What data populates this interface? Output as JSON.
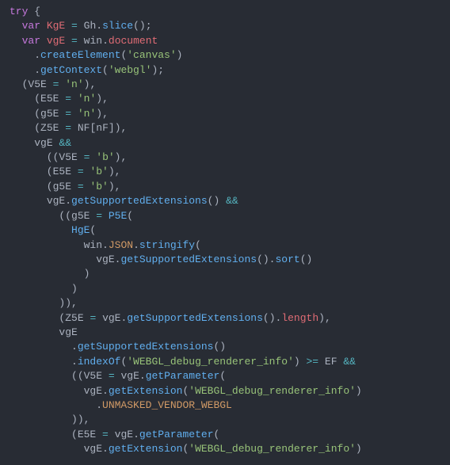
{
  "tokens": [
    [
      [
        "kw",
        "try"
      ],
      [
        "punc",
        " "
      ],
      [
        "brace",
        "{"
      ]
    ],
    [
      [
        "punc",
        "  "
      ],
      [
        "kw",
        "var"
      ],
      [
        "punc",
        " "
      ],
      [
        "var",
        "KgE"
      ],
      [
        "punc",
        " "
      ],
      [
        "op",
        "="
      ],
      [
        "punc",
        " "
      ],
      [
        "ident",
        "Gh"
      ],
      [
        "punc",
        "."
      ],
      [
        "func",
        "slice"
      ],
      [
        "punc",
        "();"
      ]
    ],
    [
      [
        "punc",
        "  "
      ],
      [
        "kw",
        "var"
      ],
      [
        "punc",
        " "
      ],
      [
        "var",
        "vgE"
      ],
      [
        "punc",
        " "
      ],
      [
        "op",
        "="
      ],
      [
        "punc",
        " "
      ],
      [
        "ident",
        "win"
      ],
      [
        "punc",
        "."
      ],
      [
        "prop",
        "document"
      ]
    ],
    [
      [
        "punc",
        "    ."
      ],
      [
        "func",
        "createElement"
      ],
      [
        "punc",
        "("
      ],
      [
        "str",
        "'canvas'"
      ],
      [
        "punc",
        ")"
      ]
    ],
    [
      [
        "punc",
        "    ."
      ],
      [
        "func",
        "getContext"
      ],
      [
        "punc",
        "("
      ],
      [
        "str",
        "'webgl'"
      ],
      [
        "punc",
        ");"
      ]
    ],
    [
      [
        "punc",
        "  ("
      ],
      [
        "ident",
        "V5E"
      ],
      [
        "punc",
        " "
      ],
      [
        "op",
        "="
      ],
      [
        "punc",
        " "
      ],
      [
        "str",
        "'n'"
      ],
      [
        "punc",
        "),"
      ]
    ],
    [
      [
        "punc",
        "    ("
      ],
      [
        "ident",
        "E5E"
      ],
      [
        "punc",
        " "
      ],
      [
        "op",
        "="
      ],
      [
        "punc",
        " "
      ],
      [
        "str",
        "'n'"
      ],
      [
        "punc",
        "),"
      ]
    ],
    [
      [
        "punc",
        "    ("
      ],
      [
        "ident",
        "g5E"
      ],
      [
        "punc",
        " "
      ],
      [
        "op",
        "="
      ],
      [
        "punc",
        " "
      ],
      [
        "str",
        "'n'"
      ],
      [
        "punc",
        "),"
      ]
    ],
    [
      [
        "punc",
        "    ("
      ],
      [
        "ident",
        "Z5E"
      ],
      [
        "punc",
        " "
      ],
      [
        "op",
        "="
      ],
      [
        "punc",
        " "
      ],
      [
        "ident",
        "NF"
      ],
      [
        "brk",
        "["
      ],
      [
        "ident",
        "nF"
      ],
      [
        "brk",
        "]"
      ],
      [
        "punc",
        "),"
      ]
    ],
    [
      [
        "punc",
        "    "
      ],
      [
        "ident",
        "vgE"
      ],
      [
        "punc",
        " "
      ],
      [
        "op",
        "&&"
      ]
    ],
    [
      [
        "punc",
        "      (("
      ],
      [
        "ident",
        "V5E"
      ],
      [
        "punc",
        " "
      ],
      [
        "op",
        "="
      ],
      [
        "punc",
        " "
      ],
      [
        "str",
        "'b'"
      ],
      [
        "punc",
        "),"
      ]
    ],
    [
      [
        "punc",
        "      ("
      ],
      [
        "ident",
        "E5E"
      ],
      [
        "punc",
        " "
      ],
      [
        "op",
        "="
      ],
      [
        "punc",
        " "
      ],
      [
        "str",
        "'b'"
      ],
      [
        "punc",
        "),"
      ]
    ],
    [
      [
        "punc",
        "      ("
      ],
      [
        "ident",
        "g5E"
      ],
      [
        "punc",
        " "
      ],
      [
        "op",
        "="
      ],
      [
        "punc",
        " "
      ],
      [
        "str",
        "'b'"
      ],
      [
        "punc",
        "),"
      ]
    ],
    [
      [
        "punc",
        "      "
      ],
      [
        "ident",
        "vgE"
      ],
      [
        "punc",
        "."
      ],
      [
        "func",
        "getSupportedExtensions"
      ],
      [
        "punc",
        "() "
      ],
      [
        "op",
        "&&"
      ]
    ],
    [
      [
        "punc",
        "        (("
      ],
      [
        "ident",
        "g5E"
      ],
      [
        "punc",
        " "
      ],
      [
        "op",
        "="
      ],
      [
        "punc",
        " "
      ],
      [
        "func",
        "P5E"
      ],
      [
        "punc",
        "("
      ]
    ],
    [
      [
        "punc",
        "          "
      ],
      [
        "func",
        "HgE"
      ],
      [
        "punc",
        "("
      ]
    ],
    [
      [
        "punc",
        "            "
      ],
      [
        "ident",
        "win"
      ],
      [
        "punc",
        "."
      ],
      [
        "const",
        "JSON"
      ],
      [
        "punc",
        "."
      ],
      [
        "func",
        "stringify"
      ],
      [
        "punc",
        "("
      ]
    ],
    [
      [
        "punc",
        "              "
      ],
      [
        "ident",
        "vgE"
      ],
      [
        "punc",
        "."
      ],
      [
        "func",
        "getSupportedExtensions"
      ],
      [
        "punc",
        "()."
      ],
      [
        "func",
        "sort"
      ],
      [
        "punc",
        "()"
      ]
    ],
    [
      [
        "punc",
        "            )"
      ]
    ],
    [
      [
        "punc",
        "          )"
      ]
    ],
    [
      [
        "punc",
        "        )),"
      ]
    ],
    [
      [
        "punc",
        "        ("
      ],
      [
        "ident",
        "Z5E"
      ],
      [
        "punc",
        " "
      ],
      [
        "op",
        "="
      ],
      [
        "punc",
        " "
      ],
      [
        "ident",
        "vgE"
      ],
      [
        "punc",
        "."
      ],
      [
        "func",
        "getSupportedExtensions"
      ],
      [
        "punc",
        "()."
      ],
      [
        "prop",
        "length"
      ],
      [
        "punc",
        "),"
      ]
    ],
    [
      [
        "punc",
        "        "
      ],
      [
        "ident",
        "vgE"
      ]
    ],
    [
      [
        "punc",
        "          ."
      ],
      [
        "func",
        "getSupportedExtensions"
      ],
      [
        "punc",
        "()"
      ]
    ],
    [
      [
        "punc",
        "          ."
      ],
      [
        "func",
        "indexOf"
      ],
      [
        "punc",
        "("
      ],
      [
        "str",
        "'WEBGL_debug_renderer_info'"
      ],
      [
        "punc",
        ") "
      ],
      [
        "op",
        ">="
      ],
      [
        "punc",
        " "
      ],
      [
        "ident",
        "EF"
      ],
      [
        "punc",
        " "
      ],
      [
        "op",
        "&&"
      ]
    ],
    [
      [
        "punc",
        "          (("
      ],
      [
        "ident",
        "V5E"
      ],
      [
        "punc",
        " "
      ],
      [
        "op",
        "="
      ],
      [
        "punc",
        " "
      ],
      [
        "ident",
        "vgE"
      ],
      [
        "punc",
        "."
      ],
      [
        "func",
        "getParameter"
      ],
      [
        "punc",
        "("
      ]
    ],
    [
      [
        "punc",
        "            "
      ],
      [
        "ident",
        "vgE"
      ],
      [
        "punc",
        "."
      ],
      [
        "func",
        "getExtension"
      ],
      [
        "punc",
        "("
      ],
      [
        "str",
        "'WEBGL_debug_renderer_info'"
      ],
      [
        "punc",
        ")"
      ]
    ],
    [
      [
        "punc",
        "              ."
      ],
      [
        "const",
        "UNMASKED_VENDOR_WEBGL"
      ]
    ],
    [
      [
        "punc",
        "          )),"
      ]
    ],
    [
      [
        "punc",
        "          ("
      ],
      [
        "ident",
        "E5E"
      ],
      [
        "punc",
        " "
      ],
      [
        "op",
        "="
      ],
      [
        "punc",
        " "
      ],
      [
        "ident",
        "vgE"
      ],
      [
        "punc",
        "."
      ],
      [
        "func",
        "getParameter"
      ],
      [
        "punc",
        "("
      ]
    ],
    [
      [
        "punc",
        "            "
      ],
      [
        "ident",
        "vgE"
      ],
      [
        "punc",
        "."
      ],
      [
        "func",
        "getExtension"
      ],
      [
        "punc",
        "("
      ],
      [
        "str",
        "'WEBGL_debug_renderer_info'"
      ],
      [
        "punc",
        ")"
      ]
    ]
  ]
}
